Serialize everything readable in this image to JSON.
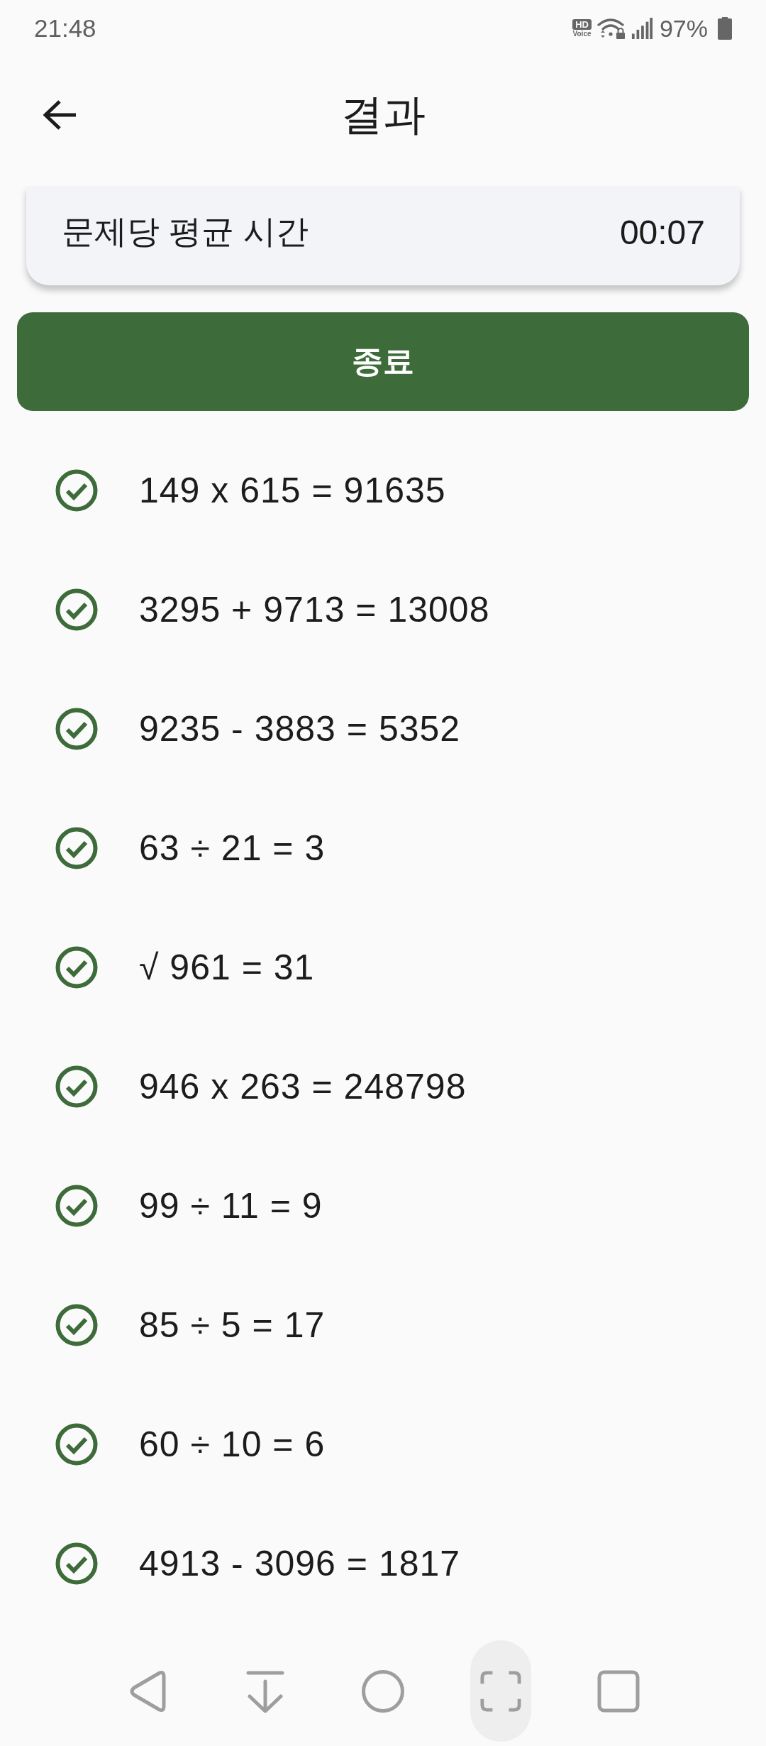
{
  "status_bar": {
    "time": "21:48",
    "hd_badge": "HD",
    "hd_caption": "Voice",
    "battery_percent": "97%"
  },
  "header": {
    "title": "결과"
  },
  "summary_card": {
    "label": "문제당 평균 시간",
    "value": "00:07"
  },
  "finish_button": {
    "label": "종료"
  },
  "results": [
    {
      "equation": "149 x 615 = 91635",
      "correct": true
    },
    {
      "equation": "3295 + 9713 = 13008",
      "correct": true
    },
    {
      "equation": "9235 - 3883 = 5352",
      "correct": true
    },
    {
      "equation": "63 ÷ 21 = 3",
      "correct": true
    },
    {
      "equation": "√ 961 = 31",
      "correct": true
    },
    {
      "equation": "946 x 263 = 248798",
      "correct": true
    },
    {
      "equation": "99 ÷ 11 = 9",
      "correct": true
    },
    {
      "equation": "85 ÷ 5 = 17",
      "correct": true
    },
    {
      "equation": "60 ÷ 10 = 6",
      "correct": true
    },
    {
      "equation": "4913 - 3096 = 1817",
      "correct": true
    }
  ],
  "nav_bar": {
    "buttons": [
      {
        "kind": "back",
        "selected": false
      },
      {
        "kind": "collapse",
        "selected": false
      },
      {
        "kind": "home",
        "selected": false
      },
      {
        "kind": "capture",
        "selected": true
      },
      {
        "kind": "recents",
        "selected": false
      }
    ]
  }
}
